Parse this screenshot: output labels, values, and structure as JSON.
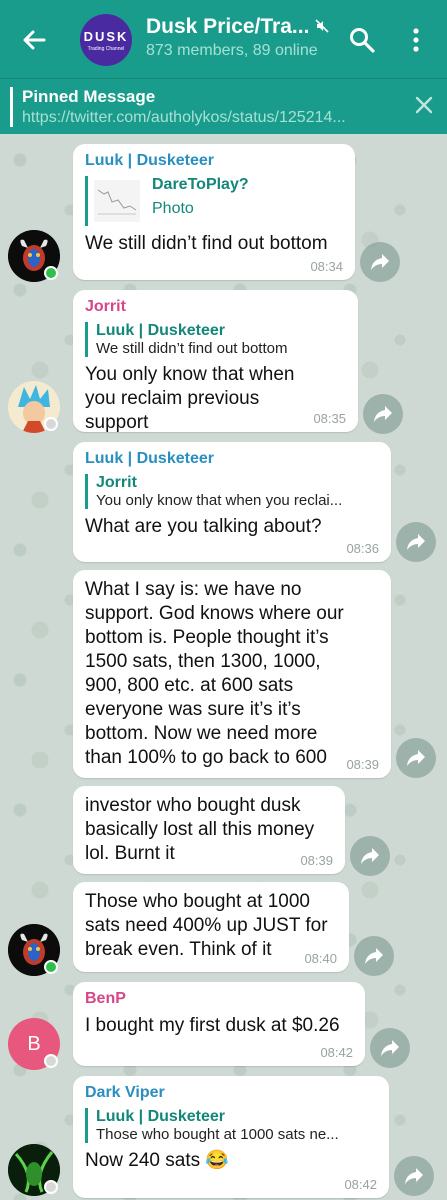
{
  "header": {
    "back_label": "Back",
    "avatar_logo": "DUSK",
    "avatar_sub": "Trading Channel",
    "title": "Dusk Price/Tra...",
    "subtitle": "873 members, 89 online",
    "colors": {
      "bar": "#1a9c8c",
      "accent": "#14877a"
    }
  },
  "pinned": {
    "title": "Pinned Message",
    "link": "https://twitter.com/autholykos/status/125214..."
  },
  "messages": [
    {
      "sender": "Luuk | Dusketeer",
      "sender_color": "#2a8fc0",
      "reply_name": "DareToPlay?",
      "reply_text": "Photo",
      "text": "We still didn’t find out bottom",
      "time": "08:34"
    },
    {
      "sender": "Jorrit",
      "sender_color": "#d6478a",
      "reply_name": "Luuk | Dusketeer",
      "reply_text": "We still didn’t find out bottom",
      "text": "You only know that when you reclaim previous support",
      "time": "08:35"
    },
    {
      "sender": "Luuk | Dusketeer",
      "sender_color": "#2a8fc0",
      "reply_name": "Jorrit",
      "reply_text": "You only know that when you reclai...",
      "text": "What are you talking about?",
      "time": "08:36"
    },
    {
      "text": "What I say is: we have no support. God knows where our bottom is. People thought it’s 1500 sats, then 1300, 1000, 900, 800 etc. at 600 sats everyone was sure it’s it’s bottom. Now we need more than 100% to go back to 600",
      "time": "08:39"
    },
    {
      "text": "investor who bought dusk basically lost all this money lol. Burnt it",
      "time": "08:39"
    },
    {
      "text": "Those who bought at 1000 sats need 400% up JUST for break even. Think of it",
      "time": "08:40"
    },
    {
      "sender": "BenP",
      "sender_color": "#d6478a",
      "avatar_letter": "B",
      "text": "I bought my first dusk at $0.26",
      "time": "08:42"
    },
    {
      "sender": "Dark Viper",
      "sender_color": "#2a8fc0",
      "reply_name": "Luuk | Dusketeer",
      "reply_text": "Those who bought at 1000 sats ne...",
      "text": "Now 240 sats 😂",
      "time": "08:42"
    }
  ]
}
